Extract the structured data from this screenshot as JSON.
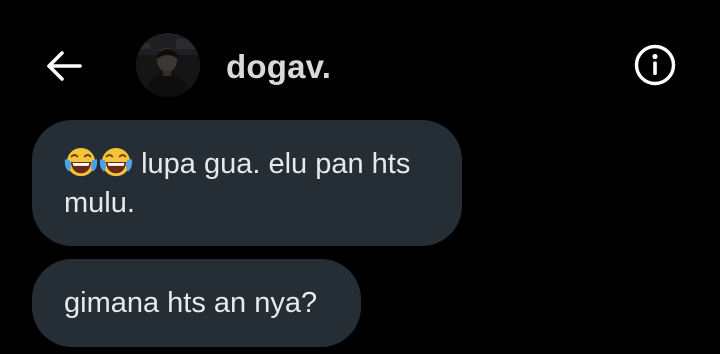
{
  "header": {
    "title": "dogav.",
    "back_icon": "arrow-left-icon",
    "info_icon": "info-icon"
  },
  "messages": [
    {
      "emojis": [
        "face-with-tears-of-joy",
        "face-with-tears-of-joy"
      ],
      "text": "lupa gua. elu pan hts mulu."
    },
    {
      "text": "gimana hts an nya?"
    }
  ],
  "colors": {
    "background": "#000000",
    "bubble": "#252d35",
    "text": "#e7e9ea",
    "title": "#d9d9d9"
  }
}
